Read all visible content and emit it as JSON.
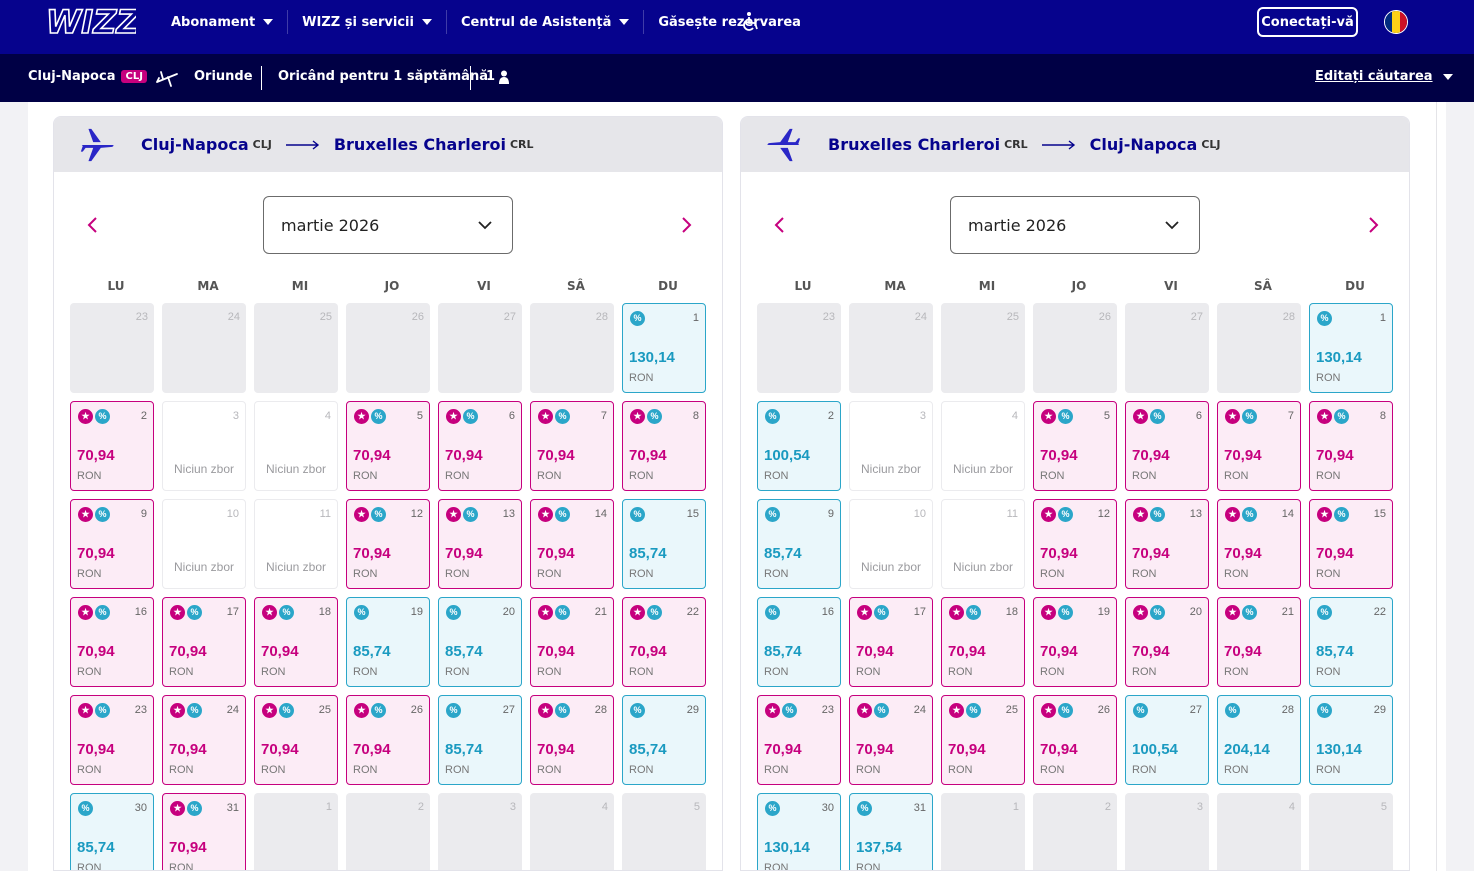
{
  "header": {
    "logo_text": "WIZZ",
    "nav": [
      {
        "label": "Abonament",
        "has_caret": true
      },
      {
        "label": "WIZZ și servicii",
        "has_caret": true
      },
      {
        "label": "Centrul de Asistență",
        "has_caret": true
      },
      {
        "label": "Găsește rezervarea",
        "has_caret": false
      }
    ],
    "accessibility_icon": "wheelchair-icon",
    "login_label": "Conectați-vă",
    "flag_colors": [
      "#002b7f",
      "#fcd116",
      "#ce1126"
    ]
  },
  "search": {
    "origin": "Cluj-Napoca",
    "origin_code": "CLJ",
    "destination": "Oriunde",
    "when": "Oricând pentru 1 săptămână",
    "passengers": "1",
    "edit_label": "Editați căutarea"
  },
  "currency": "RON",
  "no_flight_label": "Niciun zbor",
  "weekdays": [
    "LU",
    "MA",
    "MI",
    "JO",
    "VI",
    "SÂ",
    "DU"
  ],
  "colors": {
    "primary": "#06038d",
    "accent_pink": "#c6007e",
    "accent_blue": "#2ba6c9"
  },
  "panels": [
    {
      "from_city": "Cluj-Napoca",
      "from_code": "CLJ",
      "to_city": "Bruxelles Charleroi",
      "to_code": "CRL",
      "month": "martie 2026",
      "days": [
        {
          "d": "23",
          "t": "empty"
        },
        {
          "d": "24",
          "t": "empty"
        },
        {
          "d": "25",
          "t": "empty"
        },
        {
          "d": "26",
          "t": "empty"
        },
        {
          "d": "27",
          "t": "empty"
        },
        {
          "d": "28",
          "t": "empty"
        },
        {
          "d": "1",
          "t": "blue",
          "p": "130,14"
        },
        {
          "d": "2",
          "t": "pink",
          "p": "70,94"
        },
        {
          "d": "3",
          "t": "none"
        },
        {
          "d": "4",
          "t": "none"
        },
        {
          "d": "5",
          "t": "pink",
          "p": "70,94"
        },
        {
          "d": "6",
          "t": "pink",
          "p": "70,94"
        },
        {
          "d": "7",
          "t": "pink",
          "p": "70,94"
        },
        {
          "d": "8",
          "t": "pink",
          "p": "70,94"
        },
        {
          "d": "9",
          "t": "pink",
          "p": "70,94"
        },
        {
          "d": "10",
          "t": "none"
        },
        {
          "d": "11",
          "t": "none"
        },
        {
          "d": "12",
          "t": "pink",
          "p": "70,94"
        },
        {
          "d": "13",
          "t": "pink",
          "p": "70,94"
        },
        {
          "d": "14",
          "t": "pink",
          "p": "70,94"
        },
        {
          "d": "15",
          "t": "blue",
          "p": "85,74"
        },
        {
          "d": "16",
          "t": "pink",
          "p": "70,94"
        },
        {
          "d": "17",
          "t": "pink",
          "p": "70,94"
        },
        {
          "d": "18",
          "t": "pink",
          "p": "70,94"
        },
        {
          "d": "19",
          "t": "blue",
          "p": "85,74"
        },
        {
          "d": "20",
          "t": "blue",
          "p": "85,74"
        },
        {
          "d": "21",
          "t": "pink",
          "p": "70,94"
        },
        {
          "d": "22",
          "t": "pink",
          "p": "70,94"
        },
        {
          "d": "23",
          "t": "pink",
          "p": "70,94"
        },
        {
          "d": "24",
          "t": "pink",
          "p": "70,94"
        },
        {
          "d": "25",
          "t": "pink",
          "p": "70,94"
        },
        {
          "d": "26",
          "t": "pink",
          "p": "70,94"
        },
        {
          "d": "27",
          "t": "blue",
          "p": "85,74"
        },
        {
          "d": "28",
          "t": "pink",
          "p": "70,94"
        },
        {
          "d": "29",
          "t": "blue",
          "p": "85,74"
        },
        {
          "d": "30",
          "t": "blue",
          "p": "85,74"
        },
        {
          "d": "31",
          "t": "pink",
          "p": "70,94"
        },
        {
          "d": "1",
          "t": "empty"
        },
        {
          "d": "2",
          "t": "empty"
        },
        {
          "d": "3",
          "t": "empty"
        },
        {
          "d": "4",
          "t": "empty"
        },
        {
          "d": "5",
          "t": "empty"
        }
      ]
    },
    {
      "from_city": "Bruxelles Charleroi",
      "from_code": "CRL",
      "to_city": "Cluj-Napoca",
      "to_code": "CLJ",
      "month": "martie 2026",
      "days": [
        {
          "d": "23",
          "t": "empty"
        },
        {
          "d": "24",
          "t": "empty"
        },
        {
          "d": "25",
          "t": "empty"
        },
        {
          "d": "26",
          "t": "empty"
        },
        {
          "d": "27",
          "t": "empty"
        },
        {
          "d": "28",
          "t": "empty"
        },
        {
          "d": "1",
          "t": "blue",
          "p": "130,14"
        },
        {
          "d": "2",
          "t": "blue",
          "p": "100,54"
        },
        {
          "d": "3",
          "t": "none"
        },
        {
          "d": "4",
          "t": "none"
        },
        {
          "d": "5",
          "t": "pink",
          "p": "70,94"
        },
        {
          "d": "6",
          "t": "pink",
          "p": "70,94"
        },
        {
          "d": "7",
          "t": "pink",
          "p": "70,94"
        },
        {
          "d": "8",
          "t": "pink",
          "p": "70,94"
        },
        {
          "d": "9",
          "t": "blue",
          "p": "85,74"
        },
        {
          "d": "10",
          "t": "none"
        },
        {
          "d": "11",
          "t": "none"
        },
        {
          "d": "12",
          "t": "pink",
          "p": "70,94"
        },
        {
          "d": "13",
          "t": "pink",
          "p": "70,94"
        },
        {
          "d": "14",
          "t": "pink",
          "p": "70,94"
        },
        {
          "d": "15",
          "t": "pink",
          "p": "70,94"
        },
        {
          "d": "16",
          "t": "blue",
          "p": "85,74"
        },
        {
          "d": "17",
          "t": "pink",
          "p": "70,94"
        },
        {
          "d": "18",
          "t": "pink",
          "p": "70,94"
        },
        {
          "d": "19",
          "t": "pink",
          "p": "70,94"
        },
        {
          "d": "20",
          "t": "pink",
          "p": "70,94"
        },
        {
          "d": "21",
          "t": "pink",
          "p": "70,94"
        },
        {
          "d": "22",
          "t": "blue",
          "p": "85,74"
        },
        {
          "d": "23",
          "t": "pink",
          "p": "70,94"
        },
        {
          "d": "24",
          "t": "pink",
          "p": "70,94"
        },
        {
          "d": "25",
          "t": "pink",
          "p": "70,94"
        },
        {
          "d": "26",
          "t": "pink",
          "p": "70,94"
        },
        {
          "d": "27",
          "t": "blue",
          "p": "100,54"
        },
        {
          "d": "28",
          "t": "blue",
          "p": "204,14"
        },
        {
          "d": "29",
          "t": "blue",
          "p": "130,14"
        },
        {
          "d": "30",
          "t": "blue",
          "p": "130,14"
        },
        {
          "d": "31",
          "t": "blue",
          "p": "137,54"
        },
        {
          "d": "1",
          "t": "empty"
        },
        {
          "d": "2",
          "t": "empty"
        },
        {
          "d": "3",
          "t": "empty"
        },
        {
          "d": "4",
          "t": "empty"
        },
        {
          "d": "5",
          "t": "empty"
        }
      ]
    }
  ]
}
